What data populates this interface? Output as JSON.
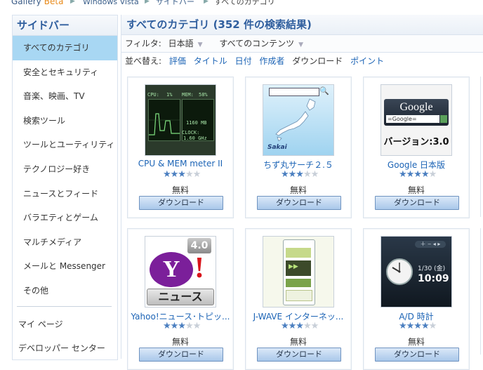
{
  "breadcrumb": {
    "home": "Gallery",
    "beta": "Beta",
    "items": [
      "Windows Vista",
      "サイドバー",
      "すべてのカテゴリ"
    ]
  },
  "sidebar": {
    "title": "サイドバー",
    "items": [
      {
        "label": "すべてのカテゴリ",
        "active": true
      },
      {
        "label": "安全とセキュリティ"
      },
      {
        "label": "音楽、映画、TV"
      },
      {
        "label": "検索ツール"
      },
      {
        "label": "ツールとユーティリティ"
      },
      {
        "label": "テクノロジー好き"
      },
      {
        "label": "ニュースとフィード"
      },
      {
        "label": "バラエティとゲーム"
      },
      {
        "label": "マルチメディア"
      },
      {
        "label": "メールと Messenger"
      },
      {
        "label": "その他"
      }
    ],
    "links": [
      "マイ ページ",
      "デベロッパー センター"
    ]
  },
  "main": {
    "title": "すべてのカテゴリ (352 件の検索結果)",
    "filter_label": "フィルタ:",
    "language": "日本語",
    "content": "すべてのコンテンツ",
    "sort_label": "並べ替え:",
    "sort_options": [
      "評価",
      "タイトル",
      "日付",
      "作成者",
      "ダウンロード",
      "ポイント"
    ]
  },
  "gadgets": [
    {
      "name": "CPU & MEM meter II",
      "rating": 3,
      "price": "無料",
      "button": "ダウンロード",
      "thumb": {
        "cpu": "CPU:",
        "cpu_pct": "1%",
        "mem": "MEM:",
        "mem_pct": "58%",
        "mem_val": "1160 MB",
        "clock": "CLOCK:",
        "clock_val": "1.60 GHz"
      }
    },
    {
      "name": "ちず丸サーチ２.５",
      "rating": 3,
      "price": "無料",
      "button": "ダウンロード",
      "thumb": {
        "logo": "Sakai"
      }
    },
    {
      "name": "Google 日本版",
      "rating": 4,
      "price": "無料",
      "button": "ダウンロード",
      "thumb": {
        "logo": "Google",
        "search_text": "=Google=",
        "version": "バージョン:3.0"
      }
    },
    {
      "name": "Yahoo!ニュース･トピッ...",
      "rating": 3,
      "price": "無料",
      "button": "ダウンロード",
      "thumb": {
        "logo_y": "Y",
        "logo_bang": "!",
        "version": "4.0",
        "label": "ニュース"
      }
    },
    {
      "name": "J-WAVE インターネッ...",
      "rating": 3,
      "price": "無料",
      "button": "ダウンロード",
      "thumb": {}
    },
    {
      "name": "A/D 時計",
      "rating": 4,
      "price": "無料",
      "button": "ダウンロード",
      "thumb": {
        "date": "1/30 (金)",
        "time": "10:09"
      }
    }
  ],
  "colors": {
    "accent": "#2f5e9e",
    "link": "#1b63b5",
    "active_bg": "#a8d7f3",
    "beta": "#e88a1a"
  }
}
